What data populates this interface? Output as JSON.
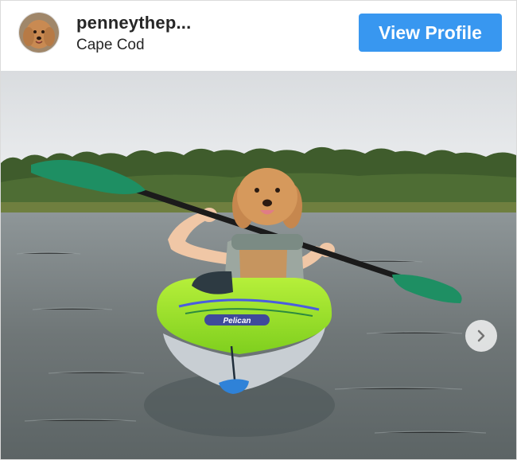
{
  "header": {
    "username": "penneythep...",
    "location": "Cape Cod",
    "view_profile_label": "View Profile"
  },
  "post": {
    "kayak_brand_text": "Pelican"
  },
  "icons": {
    "next": "chevron-right-icon",
    "avatar": "avatar"
  },
  "colors": {
    "button_blue": "#3897f0",
    "text": "#262626"
  }
}
